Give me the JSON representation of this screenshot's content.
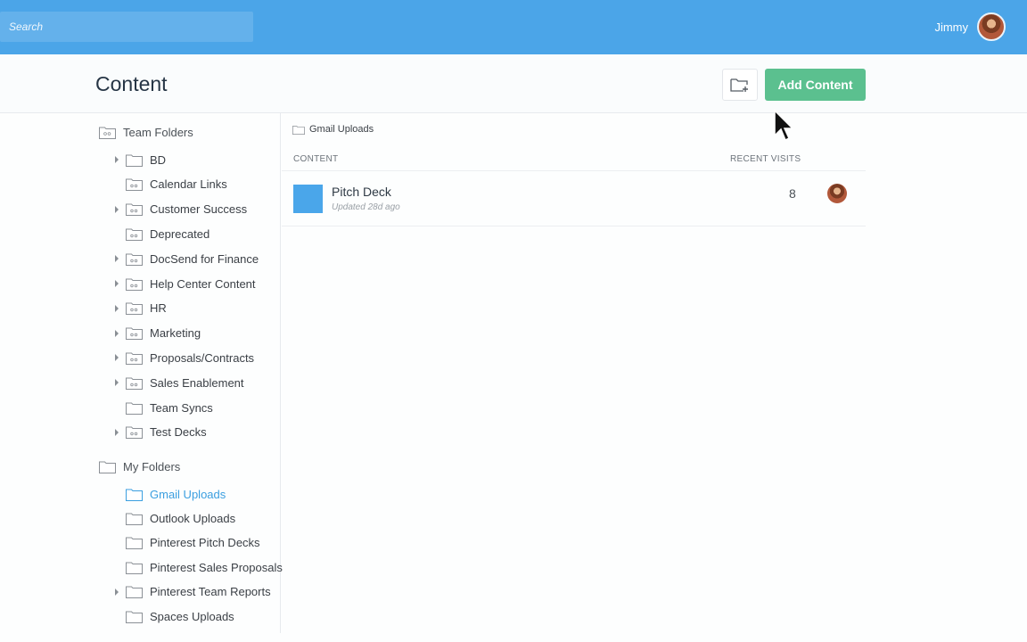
{
  "topbar": {
    "search_placeholder": "Search",
    "user_name": "Jimmy",
    "brand_color": "#4ba5e8"
  },
  "header": {
    "title": "Content",
    "new_folder_icon": "folder-plus-icon",
    "add_content_label": "Add Content",
    "add_button_color": "#5bc08f"
  },
  "sidebar": {
    "team_folders": {
      "title": "Team Folders",
      "items": [
        {
          "label": "BD",
          "expandable": true
        },
        {
          "label": "Calendar Links",
          "expandable": false
        },
        {
          "label": "Customer Success",
          "expandable": true
        },
        {
          "label": "Deprecated",
          "expandable": false
        },
        {
          "label": "DocSend for Finance",
          "expandable": true
        },
        {
          "label": "Help Center Content",
          "expandable": true
        },
        {
          "label": "HR",
          "expandable": true
        },
        {
          "label": "Marketing",
          "expandable": true
        },
        {
          "label": "Proposals/Contracts",
          "expandable": true
        },
        {
          "label": "Sales Enablement",
          "expandable": true
        },
        {
          "label": "Team Syncs",
          "expandable": false
        },
        {
          "label": "Test Decks",
          "expandable": true
        }
      ]
    },
    "my_folders": {
      "title": "My Folders",
      "items": [
        {
          "label": "Gmail Uploads",
          "expandable": false,
          "active": true
        },
        {
          "label": "Outlook Uploads",
          "expandable": false
        },
        {
          "label": "Pinterest Pitch Decks",
          "expandable": false
        },
        {
          "label": "Pinterest Sales Proposals",
          "expandable": false
        },
        {
          "label": "Pinterest Team Reports",
          "expandable": true
        },
        {
          "label": "Spaces Uploads",
          "expandable": false
        }
      ]
    },
    "active_color": "#3b9fe0"
  },
  "main": {
    "breadcrumb": "Gmail Uploads",
    "columns": {
      "content": "CONTENT",
      "recent_visits": "RECENT VISITS"
    },
    "rows": [
      {
        "title": "Pitch Deck",
        "meta": "Updated 28d ago",
        "visits": "8",
        "thumb_color": "#4aa6ea"
      }
    ]
  }
}
